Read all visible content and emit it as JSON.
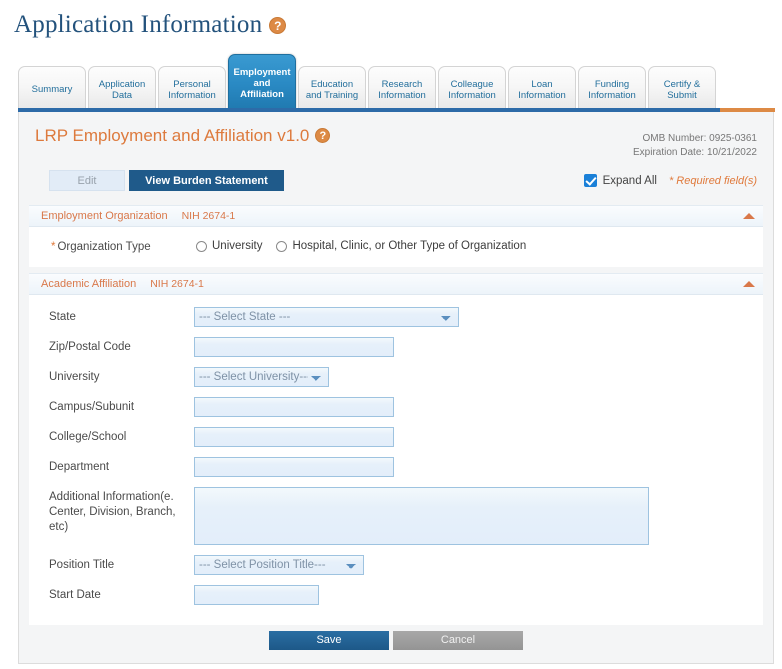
{
  "page": {
    "title": "Application Information",
    "help_icon": "help-circle-icon",
    "help_glyph": "?"
  },
  "tabs": [
    {
      "label": "Summary",
      "active": false
    },
    {
      "label": "Application Data",
      "active": false
    },
    {
      "label": "Personal Information",
      "active": false
    },
    {
      "label": "Employment and Affiliation",
      "active": true
    },
    {
      "label": "Education and Training",
      "active": false
    },
    {
      "label": "Research Information",
      "active": false
    },
    {
      "label": "Colleague Information",
      "active": false
    },
    {
      "label": "Loan Information",
      "active": false
    },
    {
      "label": "Funding Information",
      "active": false
    },
    {
      "label": "Certify & Submit",
      "active": false
    }
  ],
  "form": {
    "title": "LRP Employment and Affiliation v1.0",
    "omb_number": "OMB Number: 0925-0361",
    "expiration_date": "Expiration Date: 10/21/2022",
    "edit_label": "Edit",
    "burden_label": "View Burden Statement",
    "expand_all_label": "Expand All",
    "required_note": "* Required field(s)"
  },
  "sections": [
    {
      "title": "Employment Organization",
      "form_number": "NIH 2674-1",
      "caret_icon": "caret-up-icon",
      "org_type_label": "Organization Type",
      "org_type_required": "*",
      "options": [
        "University",
        "Hospital, Clinic, or Other Type of Organization"
      ]
    },
    {
      "title": "Academic Affiliation",
      "form_number": "NIH 2674-1",
      "caret_icon": "caret-up-icon"
    }
  ],
  "fields": {
    "state": {
      "label": "State",
      "placeholder": "--- Select State ---",
      "value": ""
    },
    "zip": {
      "label": "Zip/Postal Code",
      "value": ""
    },
    "university": {
      "label": "University",
      "placeholder": "--- Select University---",
      "value": ""
    },
    "campus": {
      "label": "Campus/Subunit",
      "value": ""
    },
    "college": {
      "label": "College/School",
      "value": ""
    },
    "department": {
      "label": "Department",
      "value": ""
    },
    "additional": {
      "label": "Additional Information(e. Center, Division, Branch, etc)",
      "value": ""
    },
    "position": {
      "label": "Position Title",
      "placeholder": "--- Select Position Title---",
      "value": ""
    },
    "start_date": {
      "label": "Start Date",
      "value": ""
    }
  },
  "footer": {
    "save_label": "Save",
    "cancel_label": "Cancel"
  },
  "colors": {
    "accent_blue": "#2d6ba8",
    "accent_orange": "#dd8a45",
    "title_blue": "#23527c",
    "section_orange": "#d9784a",
    "active_tab": "#2a8ac4"
  }
}
